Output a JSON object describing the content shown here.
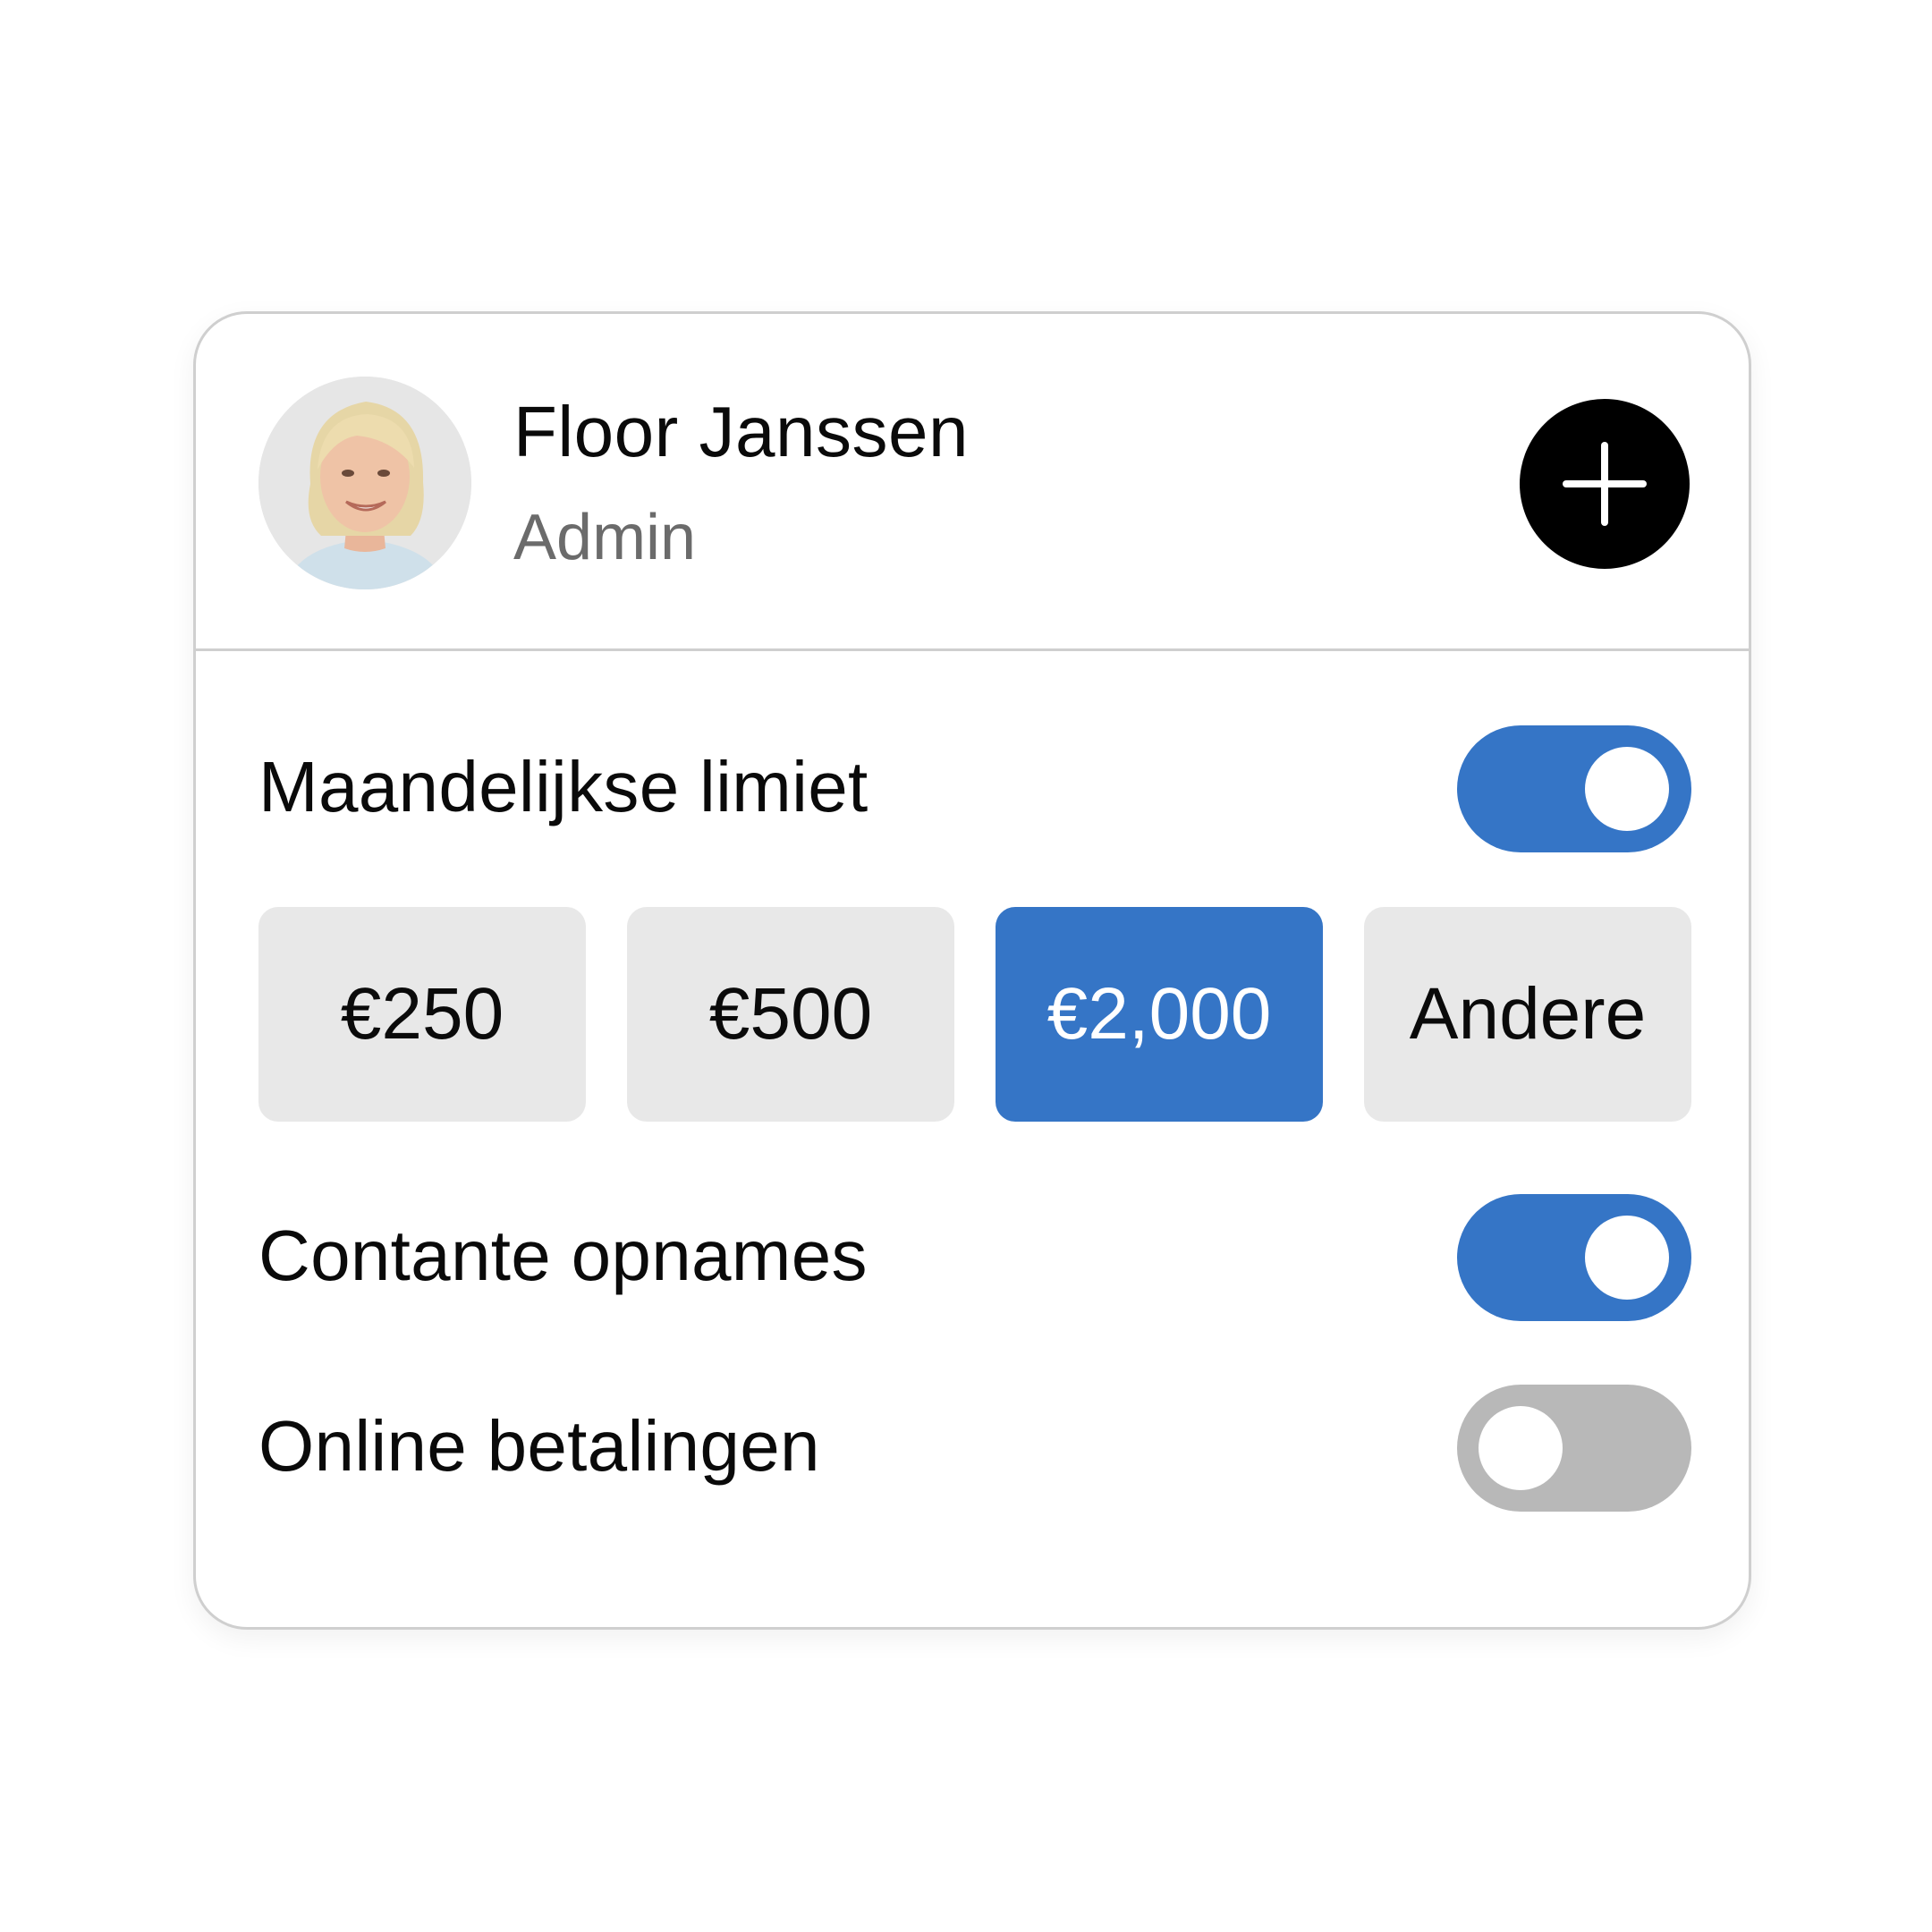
{
  "user": {
    "name": "Floor Janssen",
    "role": "Admin"
  },
  "settings": {
    "monthly_limit": {
      "label": "Maandelijkse limiet",
      "enabled": true
    },
    "amount_options": [
      {
        "label": "€250",
        "selected": false
      },
      {
        "label": "€500",
        "selected": false
      },
      {
        "label": "€2,000",
        "selected": true
      },
      {
        "label": "Andere",
        "selected": false
      }
    ],
    "cash_withdrawals": {
      "label": "Contante opnames",
      "enabled": true
    },
    "online_payments": {
      "label": "Online betalingen",
      "enabled": false
    }
  },
  "colors": {
    "accent": "#3575c6",
    "toggle_off": "#b8b8b8",
    "chip_bg": "#e8e8e8",
    "border": "#cfcfcf",
    "secondary_text": "#6b6b6b"
  },
  "icons": {
    "add": "plus-icon",
    "avatar": "user-photo"
  }
}
